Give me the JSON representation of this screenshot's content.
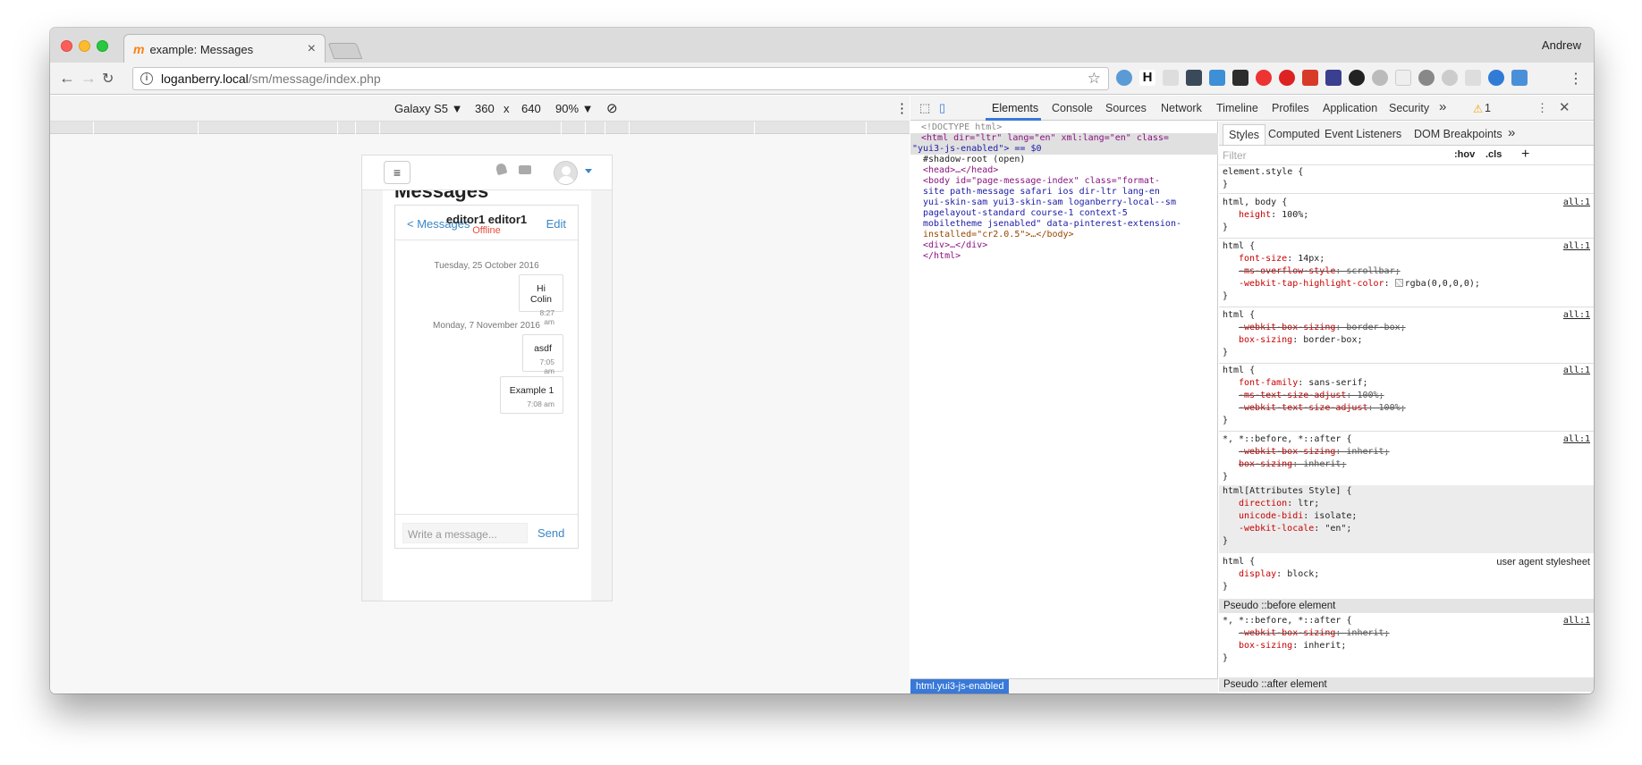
{
  "browser": {
    "tab_title": "example: Messages",
    "tab_favicon": "m",
    "profile_name": "Andrew",
    "url_host": "loganberry.local",
    "url_path": "/sm/message/index.php"
  },
  "device_bar": {
    "device": "Galaxy S5 ▼",
    "width": "360",
    "times": "x",
    "height": "640",
    "zoom": "90% ▼"
  },
  "page": {
    "heading": "Messages",
    "back_link": "< Messages",
    "contact_name": "editor1 editor1",
    "contact_status": "Offline",
    "edit_label": "Edit",
    "groups": [
      {
        "date": "Tuesday, 25 October 2016",
        "messages": [
          {
            "text": "Hi Colin",
            "time": "8:27 am"
          }
        ]
      },
      {
        "date": "Monday, 7 November 2016",
        "messages": [
          {
            "text": "asdf",
            "time": "7:05 am"
          },
          {
            "text": "Example 1",
            "time": "7:08 am"
          }
        ]
      }
    ],
    "composer_placeholder": "Write a message...",
    "send_label": "Send"
  },
  "devtools": {
    "tabs": [
      "Elements",
      "Console",
      "Sources",
      "Network",
      "Timeline",
      "Profiles",
      "Application",
      "Security"
    ],
    "more": "»",
    "warning_count": "1",
    "elements": {
      "doctype": "<!DOCTYPE html>",
      "html_line1": "<html dir=\"ltr\" lang=\"en\" xml:lang=\"en\" class=",
      "html_line2": "\"yui3-js-enabled\"> == $0",
      "shadow": "#shadow-root (open)",
      "head": "<head>…</head>",
      "body1": "<body id=\"page-message-index\" class=\"format-",
      "body2": "site  path-message safari ios dir-ltr lang-en",
      "body3": "yui-skin-sam yui3-skin-sam loganberry-local--sm",
      "body4": "pagelayout-standard course-1 context-5",
      "body5": "mobiletheme  jsenabled\" data-pinterest-extension-",
      "body6": "installed=\"cr2.0.5\">…</body>",
      "div": "<div>…</div>",
      "html_close": "</html>",
      "breadcrumb": "html.yui3-js-enabled"
    },
    "styles": {
      "tabs": [
        "Styles",
        "Computed",
        "Event Listeners",
        "DOM Breakpoints"
      ],
      "more": "»",
      "filter_placeholder": "Filter",
      "hov": ":hov",
      "cls": ".cls",
      "add": "+",
      "pseudo_before": "Pseudo ::before element",
      "pseudo_after": "Pseudo ::after element"
    }
  }
}
